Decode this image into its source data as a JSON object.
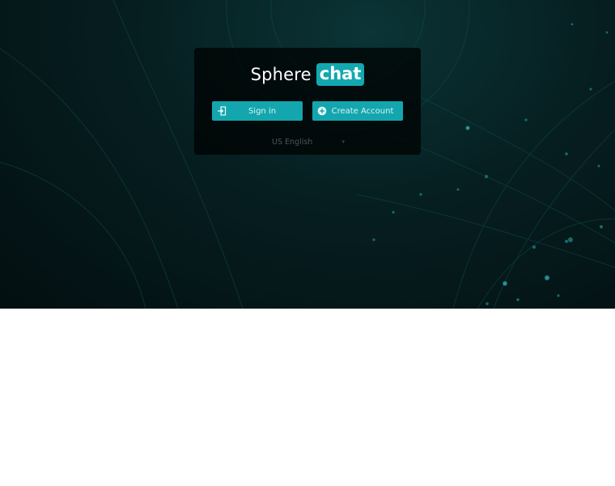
{
  "brand": {
    "word": "Sphere",
    "badge": "chat",
    "accent_color": "#13a8b0"
  },
  "actions": {
    "signin_label": "Sign in",
    "signin_icon": "sign-in-icon",
    "create_label": "Create Account",
    "create_icon": "plus-circle-icon"
  },
  "language": {
    "selected": "US English",
    "caret": "▾"
  }
}
